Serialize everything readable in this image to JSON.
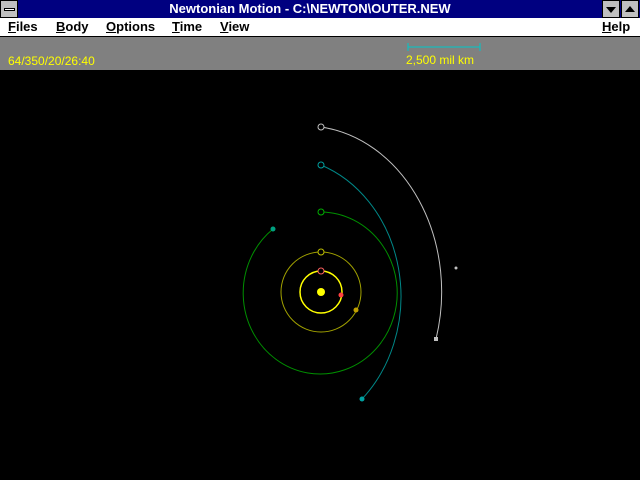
{
  "window": {
    "title": "Newtonian Motion - C:\\NEWTON\\OUTER.NEW",
    "system_menu_icon": "minus-bar-icon",
    "minimize_icon": "down-arrow-icon",
    "maximize_icon": "up-arrow-icon"
  },
  "menu": {
    "files": "Files",
    "body": "Body",
    "options": "Options",
    "time": "Time",
    "view": "View",
    "help": "Help"
  },
  "status": {
    "timecode": "64/350/20/26:40",
    "scale": "2,500 mil km"
  },
  "colors": {
    "titlebar": "#000080",
    "status_bg": "#808080",
    "status_text": "#ffff00",
    "scale_bar": "#00c8c8",
    "sun": "#ffff00",
    "orbit_inner": "#ffff00",
    "orbit_mid": "#c0c000",
    "orbit_green": "#00a000",
    "orbit_green_outer": "#009000",
    "orbit_teal": "#008888",
    "orbit_white": "#c0c0c0"
  }
}
